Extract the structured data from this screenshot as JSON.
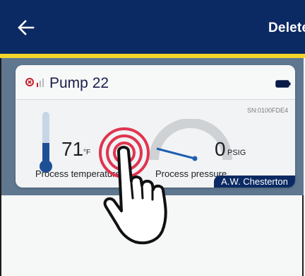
{
  "header": {
    "back_icon": "arrow-left-icon",
    "delete_label": "Delete"
  },
  "colors": {
    "appbar": "#0b2a63",
    "accent": "#f2d629",
    "backdrop": "#5f7890",
    "gauge_track": "#cfd2d4",
    "needle": "#1f5fb0",
    "tap_ripple": "#e0344f"
  },
  "device_card": {
    "status_icon": "error-icon",
    "signal_icon": "signal-weak-icon",
    "title": "Pump 22",
    "battery_icon": "battery-full-icon",
    "serial": "SN:0100FDE4",
    "temperature": {
      "value": "71",
      "unit": "°F",
      "label": "Process temperature"
    },
    "pressure": {
      "value": "0",
      "unit": "PSIG",
      "label": "Process pressure"
    },
    "brand": "A.W. Chesterton"
  },
  "overlay": {
    "gesture_icon": "tap-gesture-icon"
  }
}
